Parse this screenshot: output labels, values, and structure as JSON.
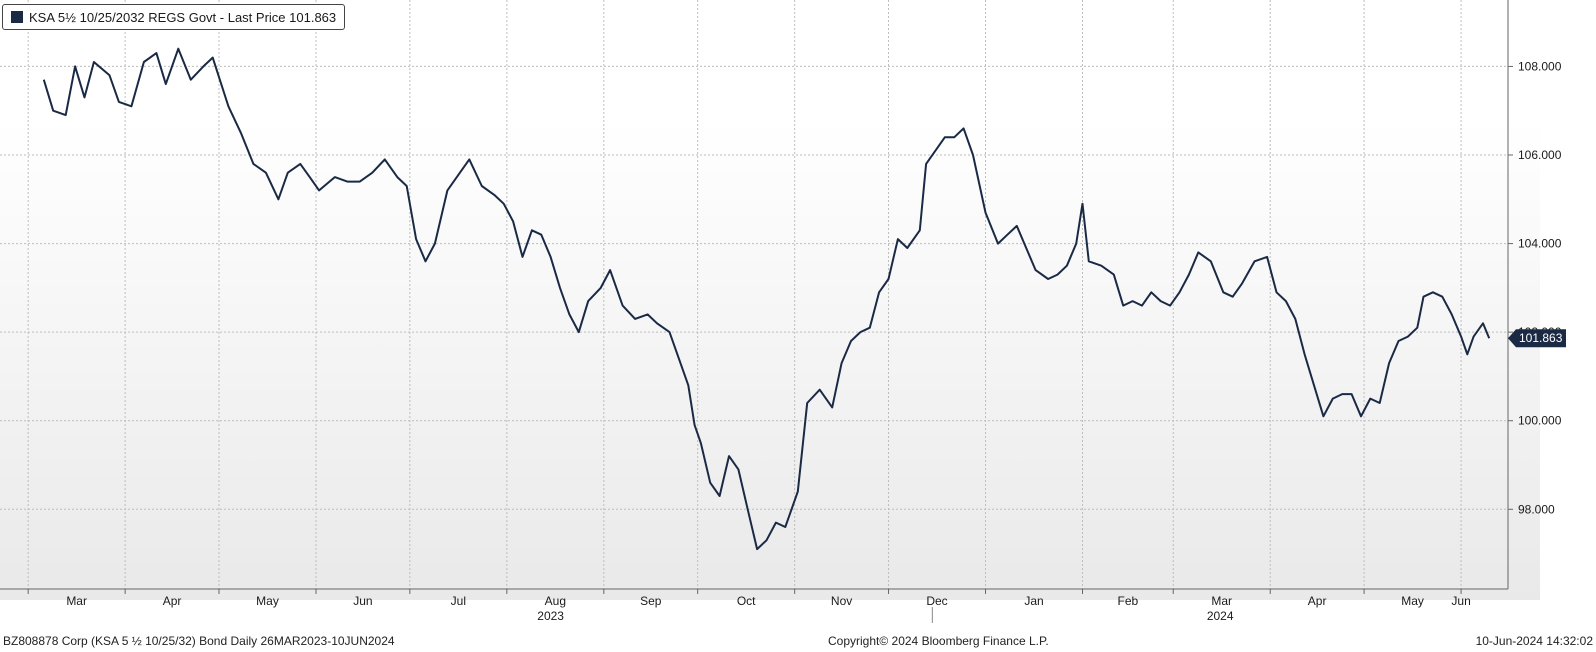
{
  "legend": {
    "text": "KSA 5½ 10/25/2032 REGS Govt - Last Price 101.863",
    "swatch_color": "#1a2a44"
  },
  "footer": {
    "left": "BZ808878 Corp (KSA 5 ½ 10/25/32) Bond  Daily 26MAR2023-10JUN2024",
    "center": "Copyright© 2024 Bloomberg Finance L.P.",
    "right": "10-Jun-2024 14:32:02"
  },
  "chart_data": {
    "type": "line",
    "series": [
      {
        "name": "KSA 5½ 10/25/2032 REGS Govt - Last Price",
        "color": "#1a2a44",
        "last_value_label": "101.863",
        "values": [
          {
            "x": "2023-03-06",
            "y": 107.7
          },
          {
            "x": "2023-03-09",
            "y": 107.0
          },
          {
            "x": "2023-03-13",
            "y": 106.9
          },
          {
            "x": "2023-03-16",
            "y": 108.0
          },
          {
            "x": "2023-03-19",
            "y": 107.3
          },
          {
            "x": "2023-03-22",
            "y": 108.1
          },
          {
            "x": "2023-03-27",
            "y": 107.8
          },
          {
            "x": "2023-03-30",
            "y": 107.2
          },
          {
            "x": "2023-04-03",
            "y": 107.1
          },
          {
            "x": "2023-04-07",
            "y": 108.1
          },
          {
            "x": "2023-04-11",
            "y": 108.3
          },
          {
            "x": "2023-04-14",
            "y": 107.6
          },
          {
            "x": "2023-04-18",
            "y": 108.4
          },
          {
            "x": "2023-04-22",
            "y": 107.7
          },
          {
            "x": "2023-04-26",
            "y": 108.0
          },
          {
            "x": "2023-04-29",
            "y": 108.2
          },
          {
            "x": "2023-05-04",
            "y": 107.1
          },
          {
            "x": "2023-05-08",
            "y": 106.5
          },
          {
            "x": "2023-05-12",
            "y": 105.8
          },
          {
            "x": "2023-05-16",
            "y": 105.6
          },
          {
            "x": "2023-05-20",
            "y": 105.0
          },
          {
            "x": "2023-05-23",
            "y": 105.6
          },
          {
            "x": "2023-05-27",
            "y": 105.8
          },
          {
            "x": "2023-05-30",
            "y": 105.5
          },
          {
            "x": "2023-06-02",
            "y": 105.2
          },
          {
            "x": "2023-06-07",
            "y": 105.5
          },
          {
            "x": "2023-06-11",
            "y": 105.4
          },
          {
            "x": "2023-06-15",
            "y": 105.4
          },
          {
            "x": "2023-06-19",
            "y": 105.6
          },
          {
            "x": "2023-06-23",
            "y": 105.9
          },
          {
            "x": "2023-06-27",
            "y": 105.5
          },
          {
            "x": "2023-06-30",
            "y": 105.3
          },
          {
            "x": "2023-07-03",
            "y": 104.1
          },
          {
            "x": "2023-07-06",
            "y": 103.6
          },
          {
            "x": "2023-07-09",
            "y": 104.0
          },
          {
            "x": "2023-07-13",
            "y": 105.2
          },
          {
            "x": "2023-07-17",
            "y": 105.6
          },
          {
            "x": "2023-07-20",
            "y": 105.9
          },
          {
            "x": "2023-07-24",
            "y": 105.3
          },
          {
            "x": "2023-07-28",
            "y": 105.1
          },
          {
            "x": "2023-07-31",
            "y": 104.9
          },
          {
            "x": "2023-08-03",
            "y": 104.5
          },
          {
            "x": "2023-08-06",
            "y": 103.7
          },
          {
            "x": "2023-08-09",
            "y": 104.3
          },
          {
            "x": "2023-08-12",
            "y": 104.2
          },
          {
            "x": "2023-08-15",
            "y": 103.7
          },
          {
            "x": "2023-08-18",
            "y": 103.0
          },
          {
            "x": "2023-08-21",
            "y": 102.4
          },
          {
            "x": "2023-08-24",
            "y": 102.0
          },
          {
            "x": "2023-08-27",
            "y": 102.7
          },
          {
            "x": "2023-08-31",
            "y": 103.0
          },
          {
            "x": "2023-09-03",
            "y": 103.4
          },
          {
            "x": "2023-09-07",
            "y": 102.6
          },
          {
            "x": "2023-09-11",
            "y": 102.3
          },
          {
            "x": "2023-09-15",
            "y": 102.4
          },
          {
            "x": "2023-09-18",
            "y": 102.2
          },
          {
            "x": "2023-09-22",
            "y": 102.0
          },
          {
            "x": "2023-09-25",
            "y": 101.4
          },
          {
            "x": "2023-09-28",
            "y": 100.8
          },
          {
            "x": "2023-09-30",
            "y": 99.9
          },
          {
            "x": "2023-10-02",
            "y": 99.5
          },
          {
            "x": "2023-10-05",
            "y": 98.6
          },
          {
            "x": "2023-10-08",
            "y": 98.3
          },
          {
            "x": "2023-10-11",
            "y": 99.2
          },
          {
            "x": "2023-10-14",
            "y": 98.9
          },
          {
            "x": "2023-10-17",
            "y": 98.0
          },
          {
            "x": "2023-10-20",
            "y": 97.1
          },
          {
            "x": "2023-10-23",
            "y": 97.3
          },
          {
            "x": "2023-10-26",
            "y": 97.7
          },
          {
            "x": "2023-10-29",
            "y": 97.6
          },
          {
            "x": "2023-11-02",
            "y": 98.4
          },
          {
            "x": "2023-11-05",
            "y": 100.4
          },
          {
            "x": "2023-11-09",
            "y": 100.7
          },
          {
            "x": "2023-11-13",
            "y": 100.3
          },
          {
            "x": "2023-11-16",
            "y": 101.3
          },
          {
            "x": "2023-11-19",
            "y": 101.8
          },
          {
            "x": "2023-11-22",
            "y": 102.0
          },
          {
            "x": "2023-11-25",
            "y": 102.1
          },
          {
            "x": "2023-11-28",
            "y": 102.9
          },
          {
            "x": "2023-12-01",
            "y": 103.2
          },
          {
            "x": "2023-12-04",
            "y": 104.1
          },
          {
            "x": "2023-12-07",
            "y": 103.9
          },
          {
            "x": "2023-12-11",
            "y": 104.3
          },
          {
            "x": "2023-12-13",
            "y": 105.8
          },
          {
            "x": "2023-12-16",
            "y": 106.1
          },
          {
            "x": "2023-12-19",
            "y": 106.4
          },
          {
            "x": "2023-12-22",
            "y": 106.4
          },
          {
            "x": "2023-12-25",
            "y": 106.6
          },
          {
            "x": "2023-12-28",
            "y": 106.0
          },
          {
            "x": "2024-01-01",
            "y": 104.7
          },
          {
            "x": "2024-01-05",
            "y": 104.0
          },
          {
            "x": "2024-01-08",
            "y": 104.2
          },
          {
            "x": "2024-01-11",
            "y": 104.4
          },
          {
            "x": "2024-01-14",
            "y": 103.9
          },
          {
            "x": "2024-01-17",
            "y": 103.4
          },
          {
            "x": "2024-01-21",
            "y": 103.2
          },
          {
            "x": "2024-01-24",
            "y": 103.3
          },
          {
            "x": "2024-01-27",
            "y": 103.5
          },
          {
            "x": "2024-01-30",
            "y": 104.0
          },
          {
            "x": "2024-02-01",
            "y": 104.9
          },
          {
            "x": "2024-02-03",
            "y": 103.6
          },
          {
            "x": "2024-02-07",
            "y": 103.5
          },
          {
            "x": "2024-02-11",
            "y": 103.3
          },
          {
            "x": "2024-02-14",
            "y": 102.6
          },
          {
            "x": "2024-02-17",
            "y": 102.7
          },
          {
            "x": "2024-02-20",
            "y": 102.6
          },
          {
            "x": "2024-02-23",
            "y": 102.9
          },
          {
            "x": "2024-02-26",
            "y": 102.7
          },
          {
            "x": "2024-02-29",
            "y": 102.6
          },
          {
            "x": "2024-03-03",
            "y": 102.9
          },
          {
            "x": "2024-03-06",
            "y": 103.3
          },
          {
            "x": "2024-03-09",
            "y": 103.8
          },
          {
            "x": "2024-03-13",
            "y": 103.6
          },
          {
            "x": "2024-03-17",
            "y": 102.9
          },
          {
            "x": "2024-03-20",
            "y": 102.8
          },
          {
            "x": "2024-03-23",
            "y": 103.1
          },
          {
            "x": "2024-03-27",
            "y": 103.6
          },
          {
            "x": "2024-03-31",
            "y": 103.7
          },
          {
            "x": "2024-04-03",
            "y": 102.9
          },
          {
            "x": "2024-04-06",
            "y": 102.7
          },
          {
            "x": "2024-04-09",
            "y": 102.3
          },
          {
            "x": "2024-04-12",
            "y": 101.5
          },
          {
            "x": "2024-04-15",
            "y": 100.8
          },
          {
            "x": "2024-04-18",
            "y": 100.1
          },
          {
            "x": "2024-04-21",
            "y": 100.5
          },
          {
            "x": "2024-04-24",
            "y": 100.6
          },
          {
            "x": "2024-04-27",
            "y": 100.6
          },
          {
            "x": "2024-04-30",
            "y": 100.1
          },
          {
            "x": "2024-05-03",
            "y": 100.5
          },
          {
            "x": "2024-05-06",
            "y": 100.4
          },
          {
            "x": "2024-05-09",
            "y": 101.3
          },
          {
            "x": "2024-05-12",
            "y": 101.8
          },
          {
            "x": "2024-05-15",
            "y": 101.9
          },
          {
            "x": "2024-05-18",
            "y": 102.1
          },
          {
            "x": "2024-05-20",
            "y": 102.8
          },
          {
            "x": "2024-05-23",
            "y": 102.9
          },
          {
            "x": "2024-05-26",
            "y": 102.8
          },
          {
            "x": "2024-05-29",
            "y": 102.4
          },
          {
            "x": "2024-06-01",
            "y": 101.9
          },
          {
            "x": "2024-06-03",
            "y": 101.5
          },
          {
            "x": "2024-06-05",
            "y": 101.9
          },
          {
            "x": "2024-06-08",
            "y": 102.2
          },
          {
            "x": "2024-06-10",
            "y": 101.863
          }
        ]
      }
    ],
    "y_ticks": [
      "98.000",
      "100.000",
      "102.000",
      "104.000",
      "106.000",
      "108.000"
    ],
    "ylim": [
      96.2,
      109.5
    ],
    "x_months": [
      {
        "label": "Mar",
        "date": "2023-03-01"
      },
      {
        "label": "Apr",
        "date": "2023-04-01"
      },
      {
        "label": "May",
        "date": "2023-05-01"
      },
      {
        "label": "Jun",
        "date": "2023-06-01"
      },
      {
        "label": "Jul",
        "date": "2023-07-01"
      },
      {
        "label": "Aug",
        "date": "2023-08-01"
      },
      {
        "label": "Sep",
        "date": "2023-09-01"
      },
      {
        "label": "Oct",
        "date": "2023-10-01"
      },
      {
        "label": "Nov",
        "date": "2023-11-01"
      },
      {
        "label": "Dec",
        "date": "2023-12-01"
      },
      {
        "label": "Jan",
        "date": "2024-01-01"
      },
      {
        "label": "Feb",
        "date": "2024-02-01"
      },
      {
        "label": "Mar",
        "date": "2024-03-01"
      },
      {
        "label": "Apr",
        "date": "2024-04-01"
      },
      {
        "label": "May",
        "date": "2024-05-01"
      },
      {
        "label": "Jun",
        "date": "2024-06-01"
      }
    ],
    "x_years": [
      {
        "label": "2023",
        "date": "2023-08-15"
      },
      {
        "label": "2024",
        "date": "2024-03-16"
      }
    ],
    "xlim": [
      "2023-02-20",
      "2024-06-16"
    ],
    "year_divider_date": "2023-12-15",
    "grid": true,
    "legend_position": "top-left"
  }
}
